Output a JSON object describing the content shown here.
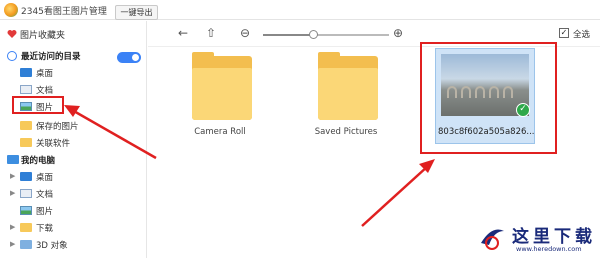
{
  "app": {
    "title": "2345看图王图片管理"
  },
  "sidebar": {
    "favorites_label": "图片收藏夹",
    "export_label": "一键导出",
    "recent_section": "最近访问的目录",
    "recent_items": [
      {
        "label": "桌面",
        "icon": "desktop-icon"
      },
      {
        "label": "文档",
        "icon": "document-icon"
      },
      {
        "label": "图片",
        "icon": "picture-icon"
      },
      {
        "label": "保存的图片",
        "icon": "folder-icon"
      },
      {
        "label": "关联软件",
        "icon": "folder-icon"
      }
    ],
    "computer_section": "我的电脑",
    "computer_items": [
      {
        "label": "桌面",
        "icon": "desktop-icon"
      },
      {
        "label": "文档",
        "icon": "document-icon"
      },
      {
        "label": "图片",
        "icon": "picture-icon"
      },
      {
        "label": "下载",
        "icon": "download-folder-icon"
      },
      {
        "label": "3D 对象",
        "icon": "3d-objects-icon"
      }
    ]
  },
  "toolbar": {
    "back_icon": "←",
    "up_icon": "⇧",
    "zoom_out_icon": "⊖",
    "zoom_in_icon": "⊕",
    "zoom_level": 0.4,
    "select_all_label": "全选",
    "select_all_checked": "✓"
  },
  "content": {
    "folders": [
      {
        "label": "Camera Roll"
      },
      {
        "label": "Saved Pictures"
      }
    ],
    "image": {
      "label": "803c8f602a505a826...",
      "selected_mark": "✓"
    }
  },
  "watermark": {
    "title": "这里下载",
    "url": "www.heredown.com"
  },
  "colors": {
    "accent": "#3b82f6",
    "annotation_red": "#e02020",
    "folder": "#f3be4f"
  }
}
